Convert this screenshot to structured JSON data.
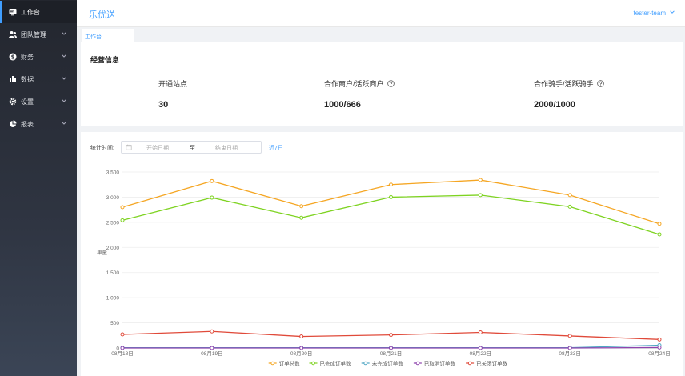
{
  "sidebar": {
    "items": [
      {
        "label": "工作台",
        "icon": "workbench-icon",
        "active": true
      },
      {
        "label": "团队管理",
        "icon": "team-icon"
      },
      {
        "label": "财务",
        "icon": "finance-icon"
      },
      {
        "label": "数据",
        "icon": "data-bar-icon"
      },
      {
        "label": "设置",
        "icon": "gear-icon"
      },
      {
        "label": "报表",
        "icon": "pie-report-icon"
      }
    ]
  },
  "header": {
    "title": "乐优送",
    "user": "tester-team"
  },
  "tabs": [
    {
      "label": "工作台"
    }
  ],
  "business": {
    "title": "经营信息",
    "stats": [
      {
        "label": "开通站点",
        "value": "30"
      },
      {
        "label": "合作商户/活跃商户",
        "value": "1000/666"
      },
      {
        "label": "合作骑手/活跃骑手",
        "value": "2000/1000"
      }
    ]
  },
  "filter": {
    "label": "统计时间:",
    "start_placeholder": "开始日期",
    "separator": "至",
    "end_placeholder": "结束日期",
    "quick": "近7日"
  },
  "colors": {
    "accent": "#409eff"
  },
  "chart_data": {
    "type": "line",
    "ylabel": "单量",
    "ylim": [
      0,
      3500
    ],
    "yticks": [
      0,
      500,
      1000,
      1500,
      2000,
      2500,
      3000,
      3500
    ],
    "ytick_labels": [
      "0",
      "500",
      "1,000",
      "1,500",
      "2,000",
      "2,500",
      "3,000",
      "3,500"
    ],
    "categories": [
      "08月18日",
      "08月19日",
      "08月20日",
      "08月21日",
      "08月22日",
      "08月23日",
      "08月24日"
    ],
    "legend_position": "bottom",
    "grid": true,
    "series": [
      {
        "name": "订单总数",
        "color": "#f5a623",
        "values": [
          2800,
          3320,
          2820,
          3250,
          3340,
          3040,
          2470
        ]
      },
      {
        "name": "已完成订单数",
        "color": "#7ed321",
        "values": [
          2540,
          2990,
          2590,
          3000,
          3040,
          2810,
          2260
        ]
      },
      {
        "name": "未完成订单数",
        "color": "#50a6c4",
        "values": [
          5,
          5,
          5,
          5,
          5,
          5,
          55
        ]
      },
      {
        "name": "已取消订单数",
        "color": "#8e44ad",
        "values": [
          0,
          0,
          0,
          0,
          0,
          0,
          10
        ]
      },
      {
        "name": "已关闭订单数",
        "color": "#e04a3a",
        "values": [
          270,
          330,
          230,
          260,
          310,
          240,
          170
        ]
      }
    ]
  }
}
